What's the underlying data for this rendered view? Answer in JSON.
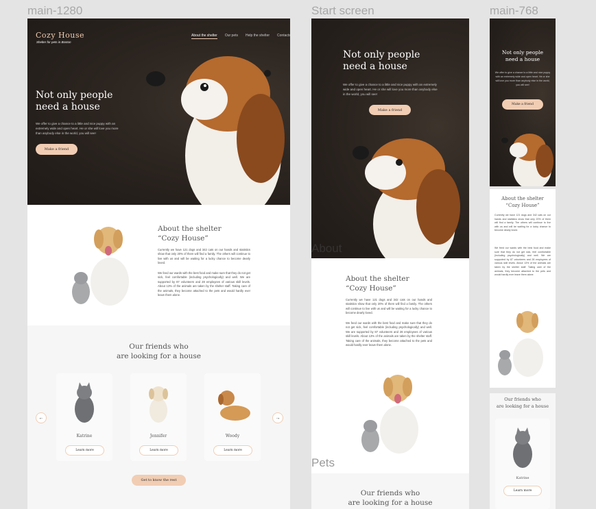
{
  "frames": {
    "main1280": "main-1280",
    "start": "Start screen",
    "main768": "main-768"
  },
  "header": {
    "logo_title": "Cozy House",
    "logo_subtitle": "Shelter for pets in Boston",
    "nav": [
      "About the shelter",
      "Our pets",
      "Help the shelter",
      "Contacts"
    ]
  },
  "hero": {
    "title_line1": "Not only people",
    "title_line2": "need a house",
    "text": "We offer to give a chance to a little and nice puppy with an extremely wide and open heart. He or she will love you more than anybody else in the world, you will see!",
    "button": "Make a friend"
  },
  "about": {
    "title_line1": "About the shelter",
    "title_line2": "“Cozy House”",
    "p1": "Currently we have 121 dogs and 342 cats on our hands and statistics show that only 20% of them will find a family. The others will continue to live with us and will be waiting for a lucky chance to become dearly loved.",
    "p2": "We feed our wards with the best food and make sure that they do not get sick, feel comfortable (including psychologically) and well. We are supported by 87 volunteers and 28 employees of various skill levels. About 13% of the animals are taken by the shelter staff. Taking care of the animals, they become attached to the pets and would hardly ever leave them alone."
  },
  "friends": {
    "title_line1": "Our friends who",
    "title_line2": "are looking for a house",
    "pets": [
      {
        "name": "Katrine",
        "button": "Learn more"
      },
      {
        "name": "Jennifer",
        "button": "Learn more"
      },
      {
        "name": "Woody",
        "button": "Learn more"
      }
    ],
    "cta": "Get to know the rest",
    "arrow_left": "←",
    "arrow_right": "→"
  },
  "overlays": {
    "about": "About",
    "pets": "Pets"
  },
  "colors": {
    "accent": "#f1cdb3",
    "hero_dark": "#2c2520",
    "canvas": "#e4e4e4"
  }
}
